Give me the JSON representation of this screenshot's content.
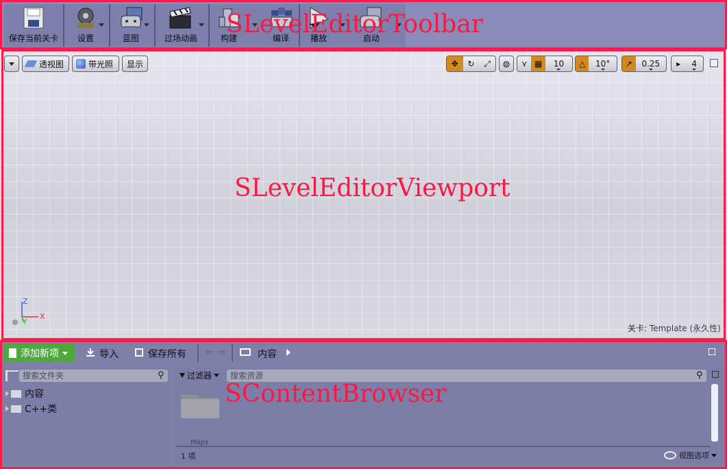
{
  "toolbar": {
    "items": [
      {
        "label": "保存当前关卡",
        "icon": "save-icon"
      },
      {
        "label": "设置",
        "icon": "settings-icon"
      },
      {
        "label": "蓝图",
        "icon": "blueprint-icon"
      },
      {
        "label": "过场动画",
        "icon": "cinematics-icon"
      },
      {
        "label": "构建",
        "icon": "build-icon"
      },
      {
        "label": "编译",
        "icon": "compile-icon"
      },
      {
        "label": "播放",
        "icon": "play-icon"
      },
      {
        "label": "启动",
        "icon": "launch-icon"
      }
    ],
    "overlay_label": "SLevelEditorToolbar"
  },
  "viewport": {
    "perspective_label": "透视图",
    "lit_label": "带光照",
    "show_label": "显示",
    "grid_snap": "10",
    "rotation_snap": "10°",
    "scale_snap": "0.25",
    "camera_speed": "4",
    "axis_z": "Z",
    "axis_x": "X",
    "axis_y": "Y",
    "level_label": "关卡:",
    "level_value": "Template (永久性)",
    "overlay_label": "SLevelEditorViewport",
    "accent": "#d28a1e"
  },
  "content_browser": {
    "add_new_label": "添加新项",
    "import_label": "导入",
    "save_all_label": "保存所有",
    "path_root": "内容",
    "folder_search_placeholder": "搜索文件夹",
    "filters_label": "过滤器",
    "asset_search_placeholder": "搜索资源",
    "tree": [
      {
        "label": "内容",
        "icon": "folder-icon"
      },
      {
        "label": "C++类",
        "icon": "cpp-folder-icon"
      }
    ],
    "assets": [
      {
        "label": "Maps",
        "icon": "folder-icon"
      }
    ],
    "item_count": "1 项",
    "view_options_label": "视图选项",
    "overlay_label": "SContentBrowser"
  }
}
